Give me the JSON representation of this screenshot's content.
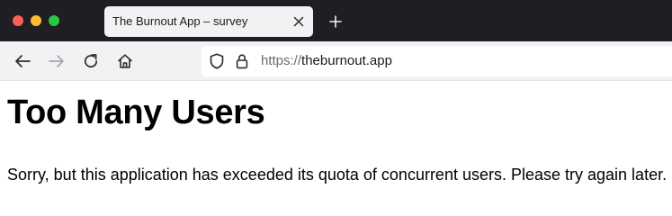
{
  "window": {
    "tab": {
      "title": "The Burnout App – survey"
    }
  },
  "toolbar": {
    "url": {
      "scheme": "https://",
      "host": "theburnout.app"
    }
  },
  "page": {
    "title": "Too Many Users",
    "message": "Sorry, but this application has exceeded its quota of concurrent users. Please try again later."
  },
  "icons": {
    "close_window": "close-window-icon",
    "minimize_window": "minimize-window-icon",
    "maximize_window": "maximize-window-icon",
    "tab_close": "close-icon",
    "new_tab": "plus-icon",
    "back": "arrow-left-icon",
    "forward": "arrow-right-icon",
    "reload": "reload-icon",
    "home": "home-icon",
    "shield": "shield-icon",
    "lock": "lock-icon"
  },
  "colors": {
    "titlebar": "#1f1e22",
    "toolbar": "#f2f2f4",
    "traffic_close": "#ff5f57",
    "traffic_minimize": "#febc2e",
    "traffic_maximize": "#28c840"
  }
}
